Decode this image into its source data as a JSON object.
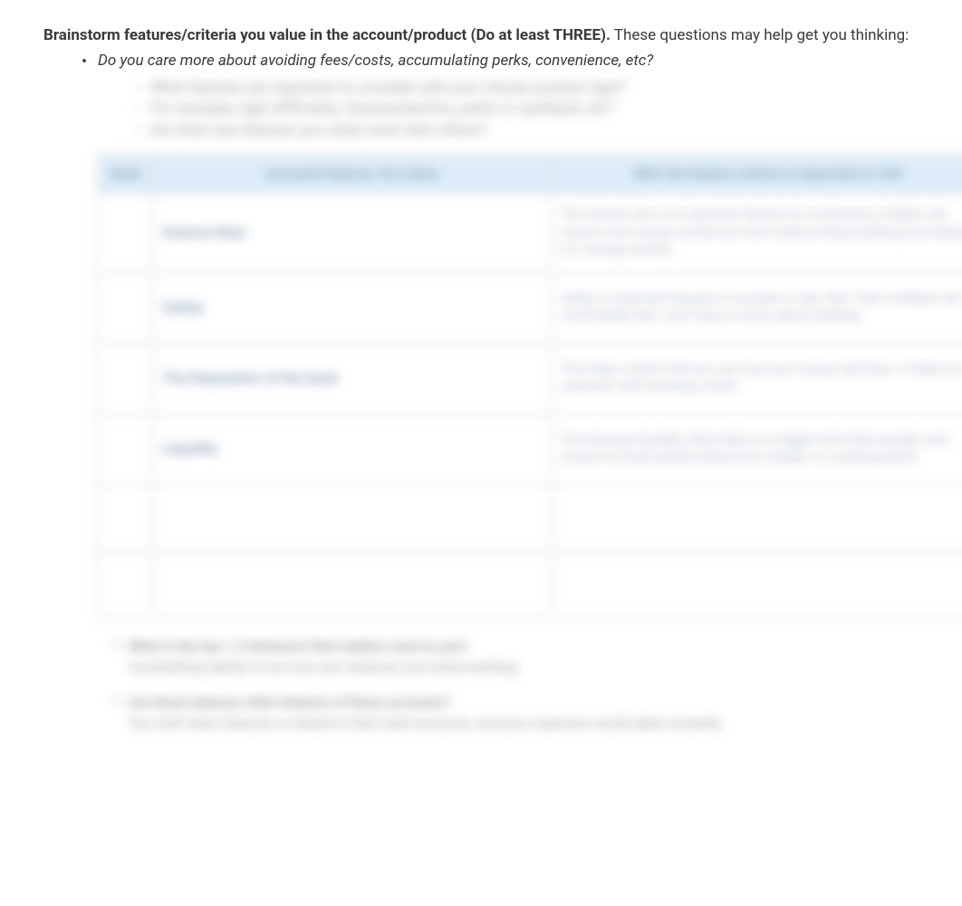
{
  "heading": {
    "bold": "Brainstorm features/criteria you value in the account/product (Do at least THREE).",
    "rest": " These questions may help get you thinking:"
  },
  "bullet1": "Do you care more about avoiding fees/costs, accumulating perks, convenience, etc?",
  "sub_bullets": [
    "What features are important to consider with your chosen product type?",
    "For example, high APR/rates, fraud protection, perks or cashback, etc?",
    "Are there any features you value more than others?"
  ],
  "table": {
    "headers": {
      "rank": "Rank",
      "feature": "Account/Features You Value",
      "why": "WHY the feature criteria is important to YOU"
    },
    "rows": [
      {
        "feature": "Interest Rate",
        "why": "The interest rate is an important feature for me because a higher rate means more money earned over time without doing anything, just keeping it in savings activity."
      },
      {
        "feature": "Safety",
        "why": "Safety is important because if my bank is safe, then I feel confident and comfortable that I won't have to worry about anything."
      },
      {
        "feature": "The Reputation of the bank",
        "why": "This helps confirm that you can trust your money with them. It helps me customer with choosing a bank."
      },
      {
        "feature": "Liquidity",
        "why": "This because liquidity often helps on a bigger level when people want access to funds quickly without too charges or a waiting period."
      }
    ]
  },
  "post1": {
    "q": "What is the top 1-2 feature(s) that matters most to you?",
    "a": "Overdrafting (ability to not over your balance) and online banking."
  },
  "post2": {
    "q": "Are these features often features of these accounts?",
    "a": "Yes, both these features is related to their bank accounts, and your expenses would taken instantly."
  }
}
